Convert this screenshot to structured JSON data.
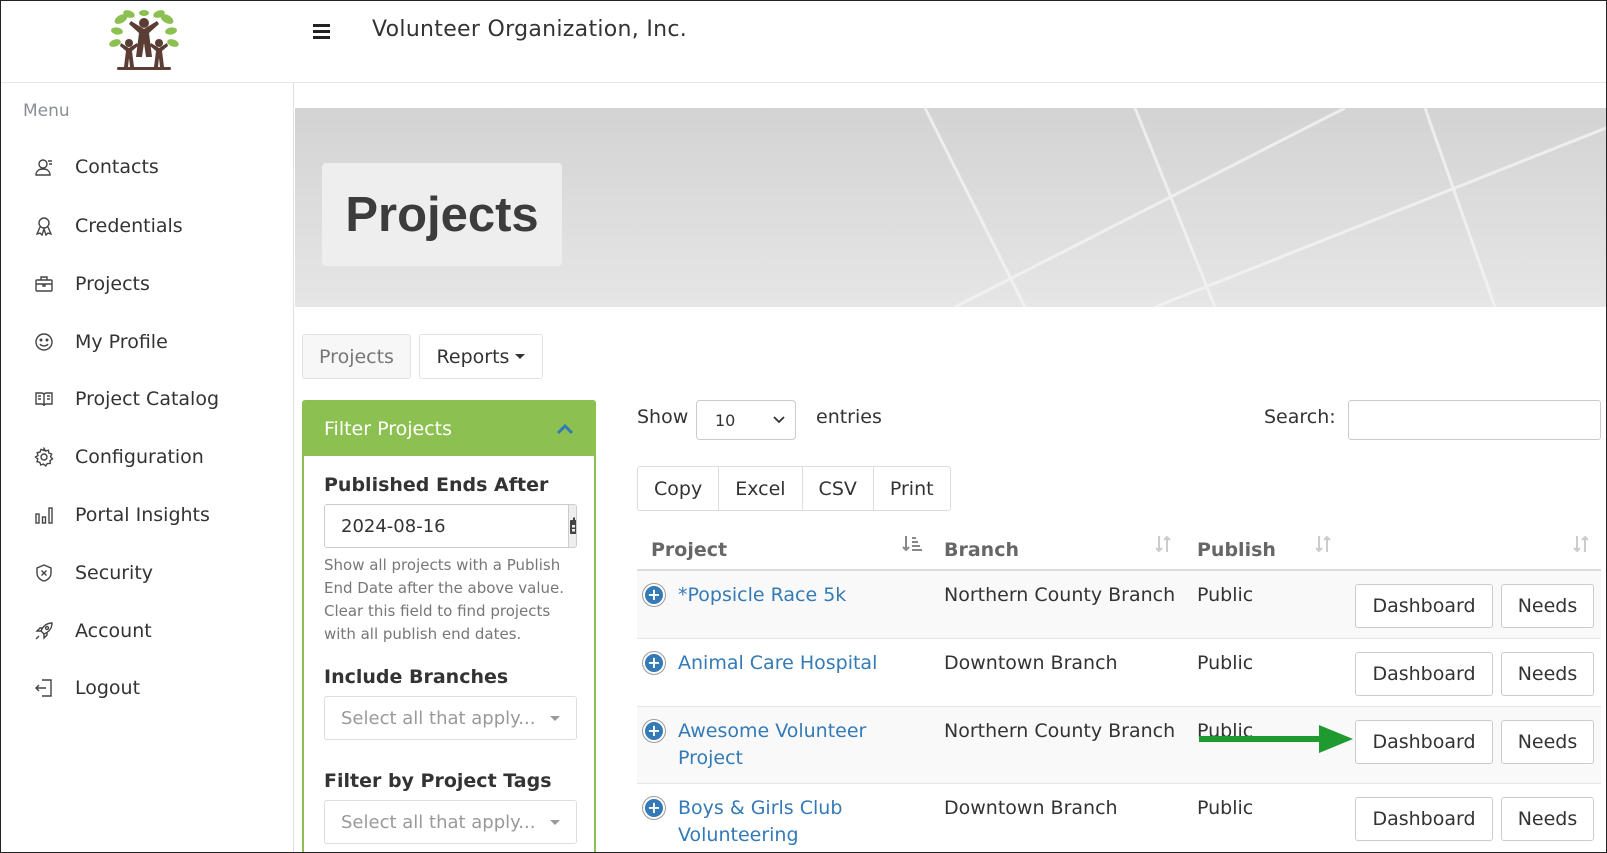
{
  "header": {
    "org_title": "Volunteer Organization, Inc.",
    "menu_icon": "hamburger-icon",
    "logo_icon": "family-tree-logo"
  },
  "sidebar": {
    "menu_label": "Menu",
    "items": [
      {
        "label": "Contacts",
        "icon": "contacts-icon"
      },
      {
        "label": "Credentials",
        "icon": "award-ribbon-icon"
      },
      {
        "label": "Projects",
        "icon": "briefcase-icon"
      },
      {
        "label": "My Profile",
        "icon": "smiley-icon"
      },
      {
        "label": "Project Catalog",
        "icon": "open-book-icon"
      },
      {
        "label": "Configuration",
        "icon": "gear-icon"
      },
      {
        "label": "Portal Insights",
        "icon": "bar-chart-icon"
      },
      {
        "label": "Security",
        "icon": "shield-icon"
      },
      {
        "label": "Account",
        "icon": "rocket-icon"
      },
      {
        "label": "Logout",
        "icon": "logout-icon"
      }
    ]
  },
  "banner": {
    "title": "Projects"
  },
  "tabs": {
    "projects": "Projects",
    "reports": "Reports"
  },
  "filter": {
    "title": "Filter Projects",
    "published_label": "Published Ends After",
    "published_value": "2024-08-16",
    "published_help": "Show all projects with a Publish End Date after the above value. Clear this field to find projects with all publish end dates.",
    "branches_label": "Include Branches",
    "branches_placeholder": "Select all that apply...",
    "tags_label": "Filter by Project Tags",
    "tags_placeholder": "Select all that apply..."
  },
  "table_controls": {
    "show_label": "Show",
    "entries_value": "10",
    "entries_label": "entries",
    "search_label": "Search:",
    "search_value": "",
    "export_buttons": [
      "Copy",
      "Excel",
      "CSV",
      "Print"
    ]
  },
  "table": {
    "columns": [
      "Project",
      "Branch",
      "Publish",
      ""
    ],
    "rows": [
      {
        "project": "*Popsicle Race 5k",
        "branch": "Northern County Branch",
        "publish": "Public",
        "dashboard": "Dashboard",
        "needs": "Needs"
      },
      {
        "project": "Animal Care Hospital",
        "branch": "Downtown Branch",
        "publish": "Public",
        "dashboard": "Dashboard",
        "needs": "Needs"
      },
      {
        "project_line1": "Awesome Volunteer",
        "project_line2": "Project",
        "branch": "Northern County Branch",
        "publish": "Public",
        "dashboard": "Dashboard",
        "needs": "Needs"
      },
      {
        "project_line1": "Boys & Girls Club",
        "project_line2": "Volunteering",
        "branch": "Downtown Branch",
        "publish": "Public",
        "dashboard": "Dashboard",
        "needs": "Needs"
      }
    ]
  },
  "annotation": {
    "arrow_color": "#1e9a2f",
    "arrow_icon": "green-arrow-right-icon"
  },
  "colors": {
    "accent_green": "#8cc152",
    "link_blue": "#337ab7"
  }
}
